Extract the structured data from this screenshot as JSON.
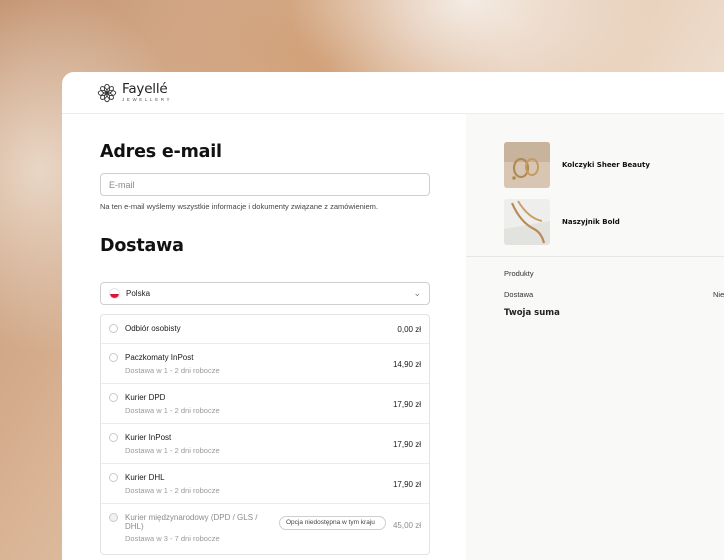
{
  "brand": {
    "name": "Fayellé",
    "tagline": "JEWELLERY"
  },
  "email_section": {
    "title": "Adres e-mail",
    "placeholder": "E-mail",
    "hint": "Na ten e-mail wyślemy wszystkie informacje i dokumenty związane z zamówieniem."
  },
  "shipping": {
    "title": "Dostawa",
    "country": "Polska",
    "options": [
      {
        "label": "Odbiór osobisty",
        "sub": "",
        "price": "0,00 zł"
      },
      {
        "label": "Paczkomaty InPost",
        "sub": "Dostawa w 1 - 2 dni robocze",
        "price": "14,90 zł"
      },
      {
        "label": "Kurier DPD",
        "sub": "Dostawa w 1 - 2 dni robocze",
        "price": "17,90 zł"
      },
      {
        "label": "Kurier InPost",
        "sub": "Dostawa w 1 - 2 dni robocze",
        "price": "17,90 zł"
      },
      {
        "label": "Kurier DHL",
        "sub": "Dostawa w 1 - 2 dni robocze",
        "price": "17,90 zł"
      },
      {
        "label": "Kurier międzynarodowy (DPD / GLS / DHL)",
        "sub": "Dostawa w 3 - 7 dni robocze",
        "price": "45,00 zł",
        "badge": "Opcja niedostępna w tym kraju",
        "disabled": true
      }
    ]
  },
  "summary": {
    "products": [
      {
        "name": "Kolczyki Sheer Beauty"
      },
      {
        "name": "Naszyjnik Bold"
      }
    ],
    "products_label": "Produkty",
    "shipping_label": "Dostawa",
    "shipping_value": "Nie",
    "total_label": "Twoja suma"
  },
  "colors": {
    "flag_red": "#dc143c",
    "accent_text": "#111111"
  }
}
